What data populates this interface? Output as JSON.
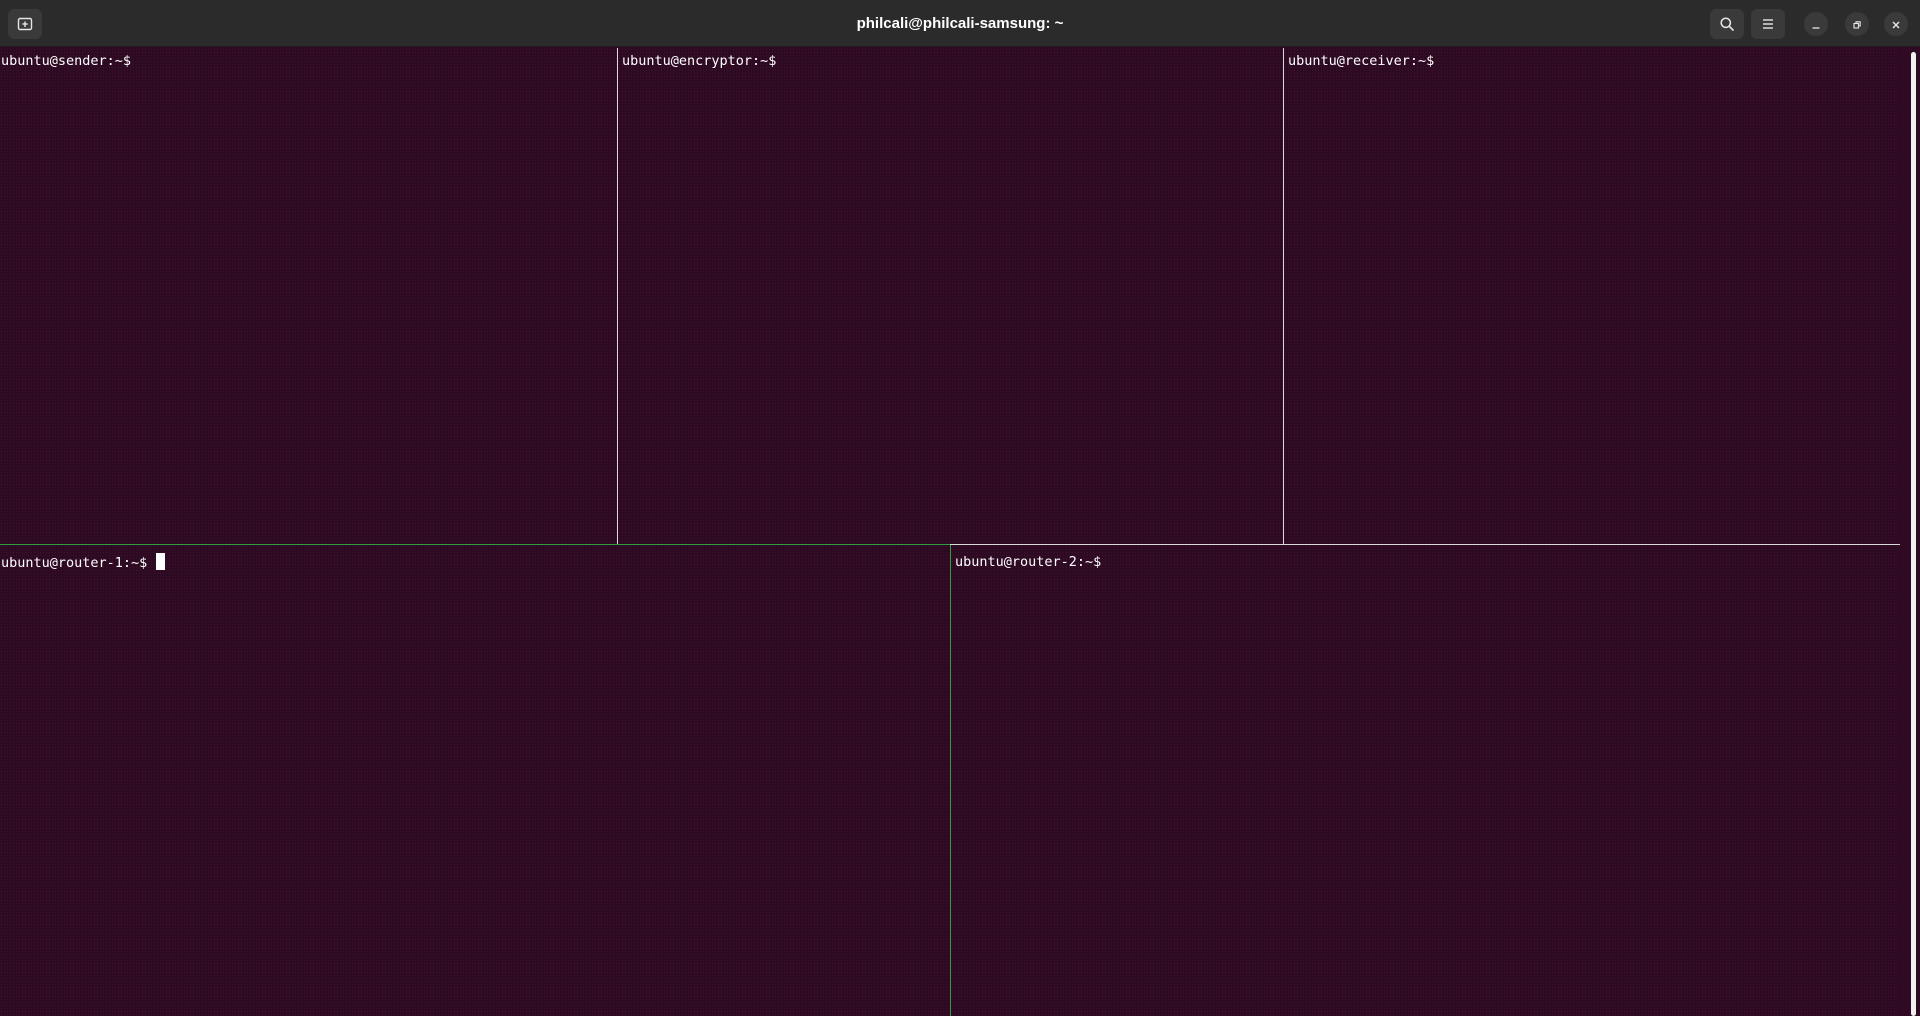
{
  "window": {
    "title": "philcali@philcali-samsung: ~"
  },
  "titlebar": {
    "new_tab_icon": "new-tab-icon",
    "search_icon": "search-icon",
    "menu_icon": "hamburger-menu-icon",
    "minimize_icon": "minimize-icon",
    "maximize_icon": "restore-icon",
    "close_icon": "close-icon"
  },
  "panes": [
    {
      "name": "sender",
      "prompt": "ubuntu@sender:~$"
    },
    {
      "name": "encryptor",
      "prompt": "ubuntu@encryptor:~$"
    },
    {
      "name": "receiver",
      "prompt": "ubuntu@receiver:~$"
    },
    {
      "name": "router-1",
      "prompt": "ubuntu@router-1:~$",
      "active": true
    },
    {
      "name": "router-2",
      "prompt": "ubuntu@router-2:~$"
    }
  ],
  "colors": {
    "terminal_bg": "#300a24",
    "titlebar_bg": "#2b2b2b",
    "active_split": "#2ea043",
    "text": "#ffffff"
  }
}
